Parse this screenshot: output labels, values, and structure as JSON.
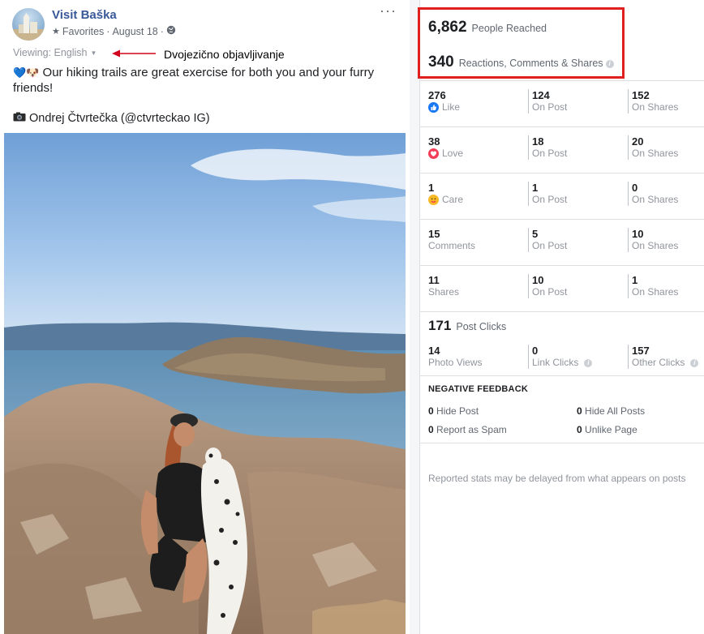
{
  "post": {
    "page_name": "Visit Baška",
    "meta": {
      "favorites_label": "Favorites",
      "separator": "·",
      "date": "August 18",
      "audience_icon": "globe-icon",
      "favorites_icon": "star-icon"
    },
    "more_icon": "more-options-icon",
    "viewing_label": "Viewing: English",
    "annotation_text": "Dvojezično objavljivanje",
    "text_emojis": "💙🐶",
    "text_body": " Our hiking trails are great exercise for both you and your furry friends!",
    "credit_icon": "camera-icon",
    "credit_text": "Ondrej Čtvrtečka (@ctvrteckao IG)"
  },
  "insights": {
    "people_reached": {
      "value": "6,862",
      "label": "People Reached"
    },
    "engagements": {
      "value": "340",
      "label": "Reactions, Comments & Shares"
    },
    "rows": [
      {
        "total": "276",
        "label": "Like",
        "on_post": "124",
        "on_post_label": "On Post",
        "on_shares": "152",
        "on_shares_label": "On Shares"
      },
      {
        "total": "38",
        "label": "Love",
        "on_post": "18",
        "on_post_label": "On Post",
        "on_shares": "20",
        "on_shares_label": "On Shares"
      },
      {
        "total": "1",
        "label": "Care",
        "on_post": "1",
        "on_post_label": "On Post",
        "on_shares": "0",
        "on_shares_label": "On Shares"
      },
      {
        "total": "15",
        "label": "Comments",
        "on_post": "5",
        "on_post_label": "On Post",
        "on_shares": "10",
        "on_shares_label": "On Shares"
      },
      {
        "total": "11",
        "label": "Shares",
        "on_post": "10",
        "on_post_label": "On Post",
        "on_shares": "1",
        "on_shares_label": "On Shares"
      }
    ],
    "post_clicks": {
      "value": "171",
      "label": "Post Clicks",
      "photo_views": "14",
      "photo_views_label": "Photo Views",
      "link_clicks": "0",
      "link_clicks_label": "Link Clicks",
      "other_clicks": "157",
      "other_clicks_label": "Other Clicks"
    },
    "negative_feedback": {
      "title": "NEGATIVE FEEDBACK",
      "hide_post": {
        "value": "0",
        "label": "Hide Post"
      },
      "hide_all": {
        "value": "0",
        "label": "Hide All Posts"
      },
      "report_spam": {
        "value": "0",
        "label": "Report as Spam"
      },
      "unlike_page": {
        "value": "0",
        "label": "Unlike Page"
      }
    },
    "footnote": "Reported stats may be delayed from what appears on posts"
  },
  "colors": {
    "page_link": "#385898",
    "highlight": "#e0201f",
    "like": "#1877f2",
    "love": "#f33e58",
    "care": "#f7b928"
  }
}
